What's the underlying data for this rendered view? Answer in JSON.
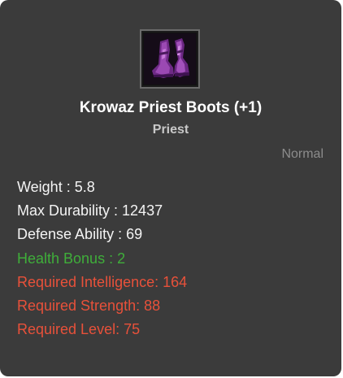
{
  "item": {
    "icon": "purple-boots-icon",
    "name": "Krowaz Priest Boots (+1)",
    "class": "Priest",
    "grade": "Normal"
  },
  "stats": {
    "weight": "Weight : 5.8",
    "max_durability": "Max Durability : 12437",
    "defense_ability": "Defense Ability : 69",
    "health_bonus": "Health Bonus : 2",
    "required_intelligence": "Required Intelligence: 164",
    "required_strength": "Required Strength: 88",
    "required_level": "Required Level: 75"
  },
  "colors": {
    "background": "#3b3b3b",
    "normal_text": "#f4f4f4",
    "bonus_text": "#3fae3a",
    "requirement_text": "#e8513a",
    "grade_text": "#8c8c8c"
  }
}
